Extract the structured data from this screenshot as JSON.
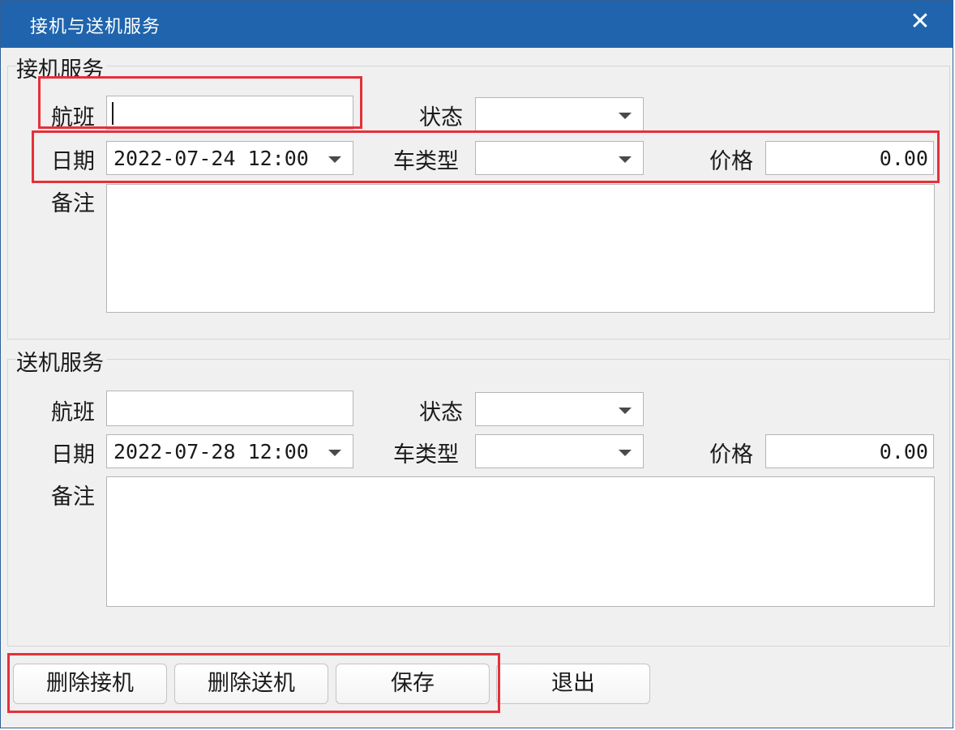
{
  "window": {
    "title": "接机与送机服务",
    "close_glyph": "✕"
  },
  "pickup": {
    "group_title": "接机服务",
    "flight_label": "航班",
    "flight_value": "",
    "status_label": "状态",
    "status_value": "",
    "date_label": "日期",
    "date_value": "2022-07-24 12:00",
    "car_type_label": "车类型",
    "car_type_value": "",
    "price_label": "价格",
    "price_value": "0.00",
    "remark_label": "备注",
    "remark_value": ""
  },
  "dropoff": {
    "group_title": "送机服务",
    "flight_label": "航班",
    "flight_value": "",
    "status_label": "状态",
    "status_value": "",
    "date_label": "日期",
    "date_value": "2022-07-28 12:00",
    "car_type_label": "车类型",
    "car_type_value": "",
    "price_label": "价格",
    "price_value": "0.00",
    "remark_label": "备注",
    "remark_value": ""
  },
  "buttons": {
    "delete_pickup": "删除接机",
    "delete_dropoff": "删除送机",
    "save": "保存",
    "exit": "退出"
  },
  "colors": {
    "titlebar": "#1f64ad",
    "highlight": "#e5303a",
    "background": "#f0f0f0"
  }
}
